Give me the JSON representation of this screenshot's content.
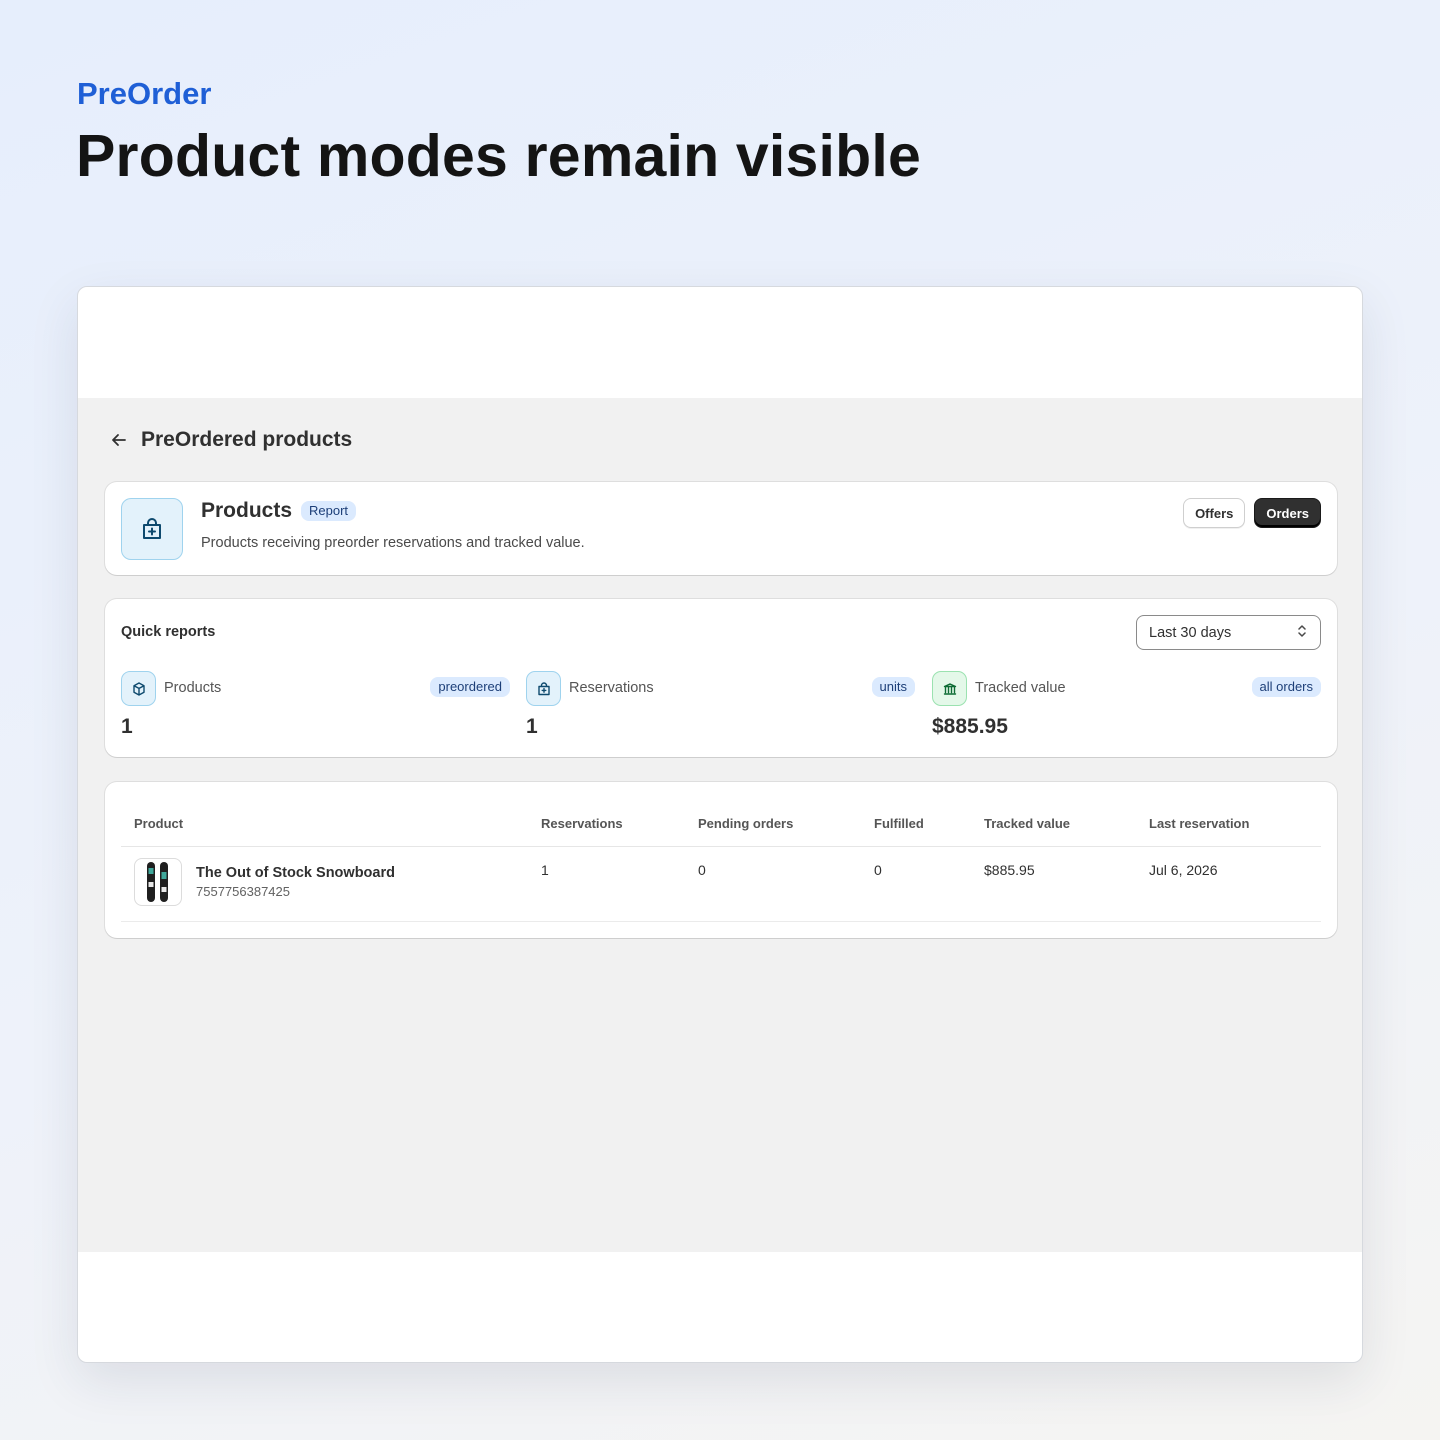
{
  "hero": {
    "brand": "PreOrder",
    "headline": "Product modes remain visible"
  },
  "page": {
    "title": "PreOrdered products"
  },
  "header_card": {
    "title": "Products",
    "badge": "Report",
    "description": "Products receiving preorder reservations and tracked value.",
    "icon": "bag-plus-icon",
    "buttons": {
      "offers": "Offers",
      "orders": "Orders"
    }
  },
  "quick_reports": {
    "title": "Quick reports",
    "range_select": {
      "value": "Last 30 days"
    },
    "metrics": [
      {
        "label": "Products",
        "badge": "preordered",
        "value": "1",
        "icon": "box-icon"
      },
      {
        "label": "Reservations",
        "badge": "units",
        "value": "1",
        "icon": "bag-plus-icon"
      },
      {
        "label": "Tracked value",
        "badge": "all orders",
        "value": "$885.95",
        "icon": "bank-icon"
      }
    ]
  },
  "table": {
    "columns": [
      "Product",
      "Reservations",
      "Pending orders",
      "Fulfilled",
      "Tracked value",
      "Last reservation"
    ],
    "rows": [
      {
        "product_name": "The Out of Stock Snowboard",
        "product_id": "7557756387425",
        "reservations": "1",
        "pending_orders": "0",
        "fulfilled": "0",
        "tracked_value": "$885.95",
        "last_reservation": "Jul 6, 2026"
      }
    ]
  },
  "colors": {
    "brand": "#1f5fd6",
    "primary_button": "#303030",
    "badge_bg": "#dbeafe",
    "admin_bg": "#f1f1f1"
  }
}
